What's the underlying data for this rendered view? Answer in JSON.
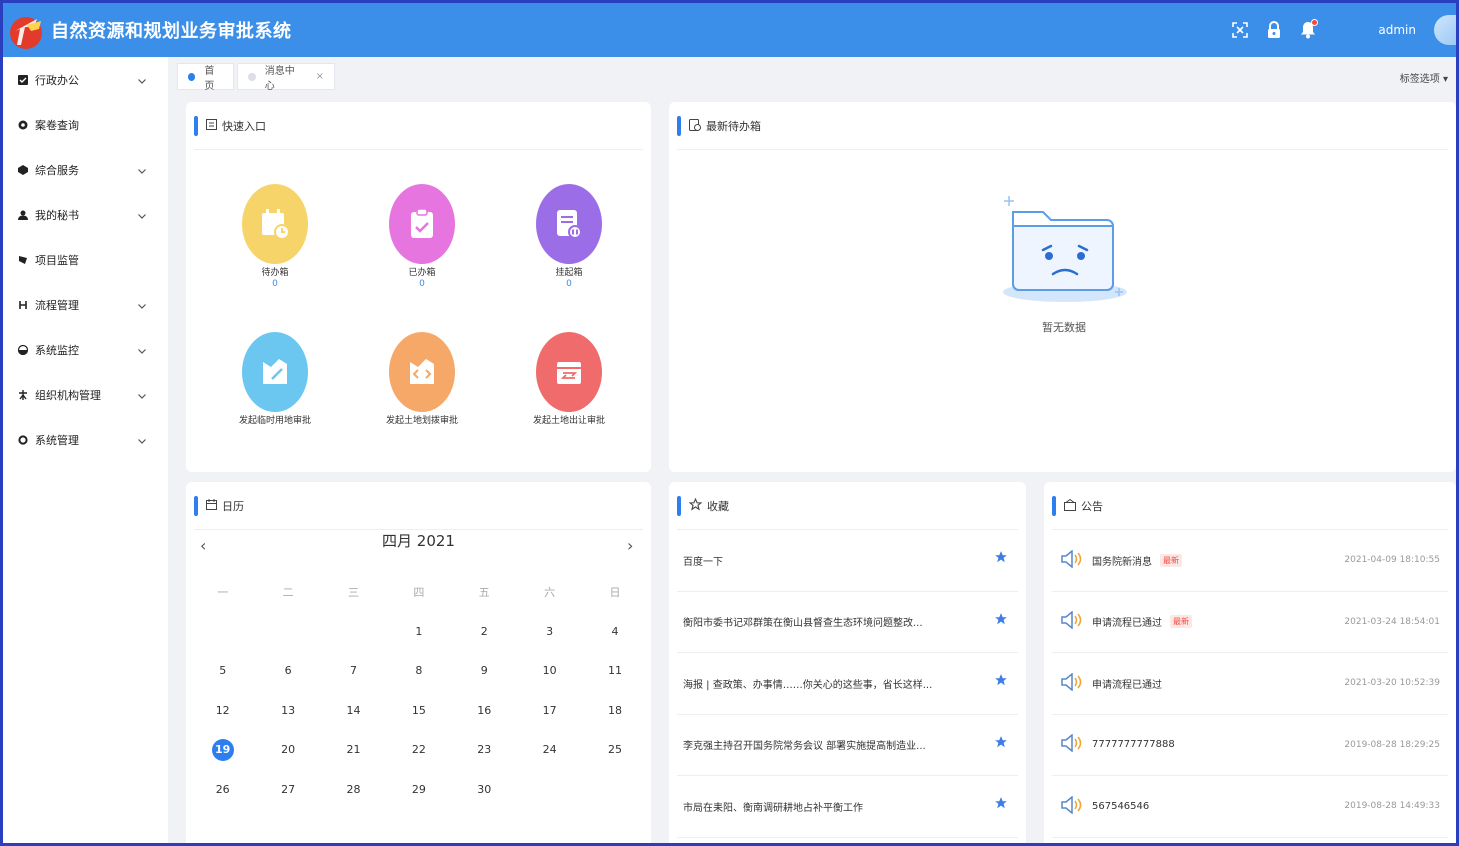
{
  "app": {
    "title": "自然资源和规划业务审批系统",
    "user": "admin"
  },
  "colors": {
    "primary": "#3b8fe8",
    "accent": "#2d7ff0",
    "badge": "#f5473a"
  },
  "header_icons": [
    "fullscreen-icon",
    "lock-icon",
    "bell-icon"
  ],
  "sidebar": {
    "items": [
      {
        "label": "行政办公",
        "icon": "office-icon",
        "expandable": true
      },
      {
        "label": "案卷查询",
        "icon": "search-icon",
        "expandable": false
      },
      {
        "label": "综合服务",
        "icon": "service-icon",
        "expandable": true
      },
      {
        "label": "我的秘书",
        "icon": "user-icon",
        "expandable": true
      },
      {
        "label": "项目监管",
        "icon": "monitor-icon",
        "expandable": false
      },
      {
        "label": "流程管理",
        "icon": "flow-icon",
        "expandable": true
      },
      {
        "label": "系统监控",
        "icon": "gauge-icon",
        "expandable": true
      },
      {
        "label": "组织机构管理",
        "icon": "org-icon",
        "expandable": true
      },
      {
        "label": "系统管理",
        "icon": "gear-icon",
        "expandable": true
      }
    ]
  },
  "tabs": {
    "items": [
      {
        "label": "首页",
        "active": true
      },
      {
        "label": "消息中心",
        "active": false,
        "closable": true
      }
    ],
    "close_glyph": "×",
    "options_label": "标签选项 ▾"
  },
  "quick_entry": {
    "title": "快速入口",
    "items": [
      {
        "label": "待办箱",
        "count": "0",
        "color": "#f7d46a"
      },
      {
        "label": "已办箱",
        "count": "0",
        "color": "#e775e0"
      },
      {
        "label": "挂起箱",
        "count": "0",
        "color": "#9b6ee8"
      },
      {
        "label": "发起临时用地审批",
        "color": "#6cc7f0"
      },
      {
        "label": "发起土地划拨审批",
        "color": "#f5a868"
      },
      {
        "label": "发起土地出让审批",
        "color": "#f06b6b"
      }
    ]
  },
  "todo": {
    "title": "最新待办箱",
    "empty_text": "暂无数据"
  },
  "calendar": {
    "title": "日历",
    "month_label": "四月 2021",
    "prev": "‹",
    "next": "›",
    "weekdays": [
      "一",
      "二",
      "三",
      "四",
      "五",
      "六",
      "日"
    ],
    "weeks": [
      [
        "",
        "",
        "",
        "1",
        "2",
        "3",
        "4"
      ],
      [
        "5",
        "6",
        "7",
        "8",
        "9",
        "10",
        "11"
      ],
      [
        "12",
        "13",
        "14",
        "15",
        "16",
        "17",
        "18"
      ],
      [
        "19",
        "20",
        "21",
        "22",
        "23",
        "24",
        "25"
      ],
      [
        "26",
        "27",
        "28",
        "29",
        "30",
        "",
        ""
      ]
    ],
    "today": "19"
  },
  "favorites": {
    "title": "收藏",
    "items": [
      "百度一下",
      "衡阳市委书记邓群策在衡山县督查生态环境问题整改...",
      "海报 | 查政策、办事情……你关心的这些事，省长这样...",
      "李克强主持召开国务院常务会议 部署实施提高制造业...",
      "市局在耒阳、衡南调研耕地占补平衡工作"
    ]
  },
  "notices": {
    "title": "公告",
    "new_label": "最新",
    "items": [
      {
        "text": "国务院新消息",
        "time": "2021-04-09 18:10:55",
        "is_new": true
      },
      {
        "text": "申请流程已通过",
        "time": "2021-03-24 18:54:01",
        "is_new": true
      },
      {
        "text": "申请流程已通过",
        "time": "2021-03-20 10:52:39",
        "is_new": false
      },
      {
        "text": "7777777777888",
        "time": "2019-08-28 18:29:25",
        "is_new": false
      },
      {
        "text": "567546546",
        "time": "2019-08-28 14:49:33",
        "is_new": false
      }
    ]
  }
}
